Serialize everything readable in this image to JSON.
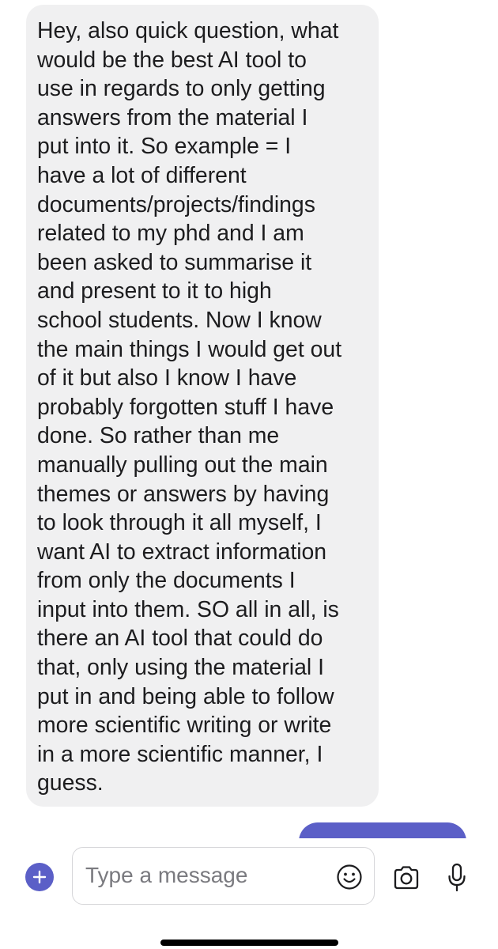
{
  "conversation": {
    "incoming_message": {
      "text": "Hey, also quick question, what\nwould be the best AI tool to\nuse in regards to only getting\nanswers from the material I\nput into it.  So example = I\nhave a lot of different\ndocuments/projects/findings\nrelated to my phd and I am\nbeen asked to summarise it\nand present to it to high\nschool students.  Now I know\nthe main things I would get out\nof it but also I know I have\nprobably forgotten stuff I have\ndone.   So rather than me\nmanually pulling out the main\nthemes or answers by having\nto look through it all myself, I\nwant AI to extract information\nfrom only the documents I\ninput into them.  SO all in all, is\nthere an AI tool that could do\nthat, only using the material I\nput in and being able to follow\nmore scientific writing or write\nin a more scientific manner, I\nguess."
    },
    "outgoing_bubble_color": "#5b5fc7"
  },
  "composer": {
    "placeholder": "Type a message",
    "value": "",
    "icons": {
      "add": "plus-icon",
      "emoji": "smiley-icon",
      "camera": "camera-icon",
      "mic": "microphone-icon"
    }
  },
  "colors": {
    "accent": "#5b5fc7",
    "incoming_bubble": "#f0f0f1",
    "text": "#1c1c1e",
    "icon": "#1c1c1e"
  }
}
